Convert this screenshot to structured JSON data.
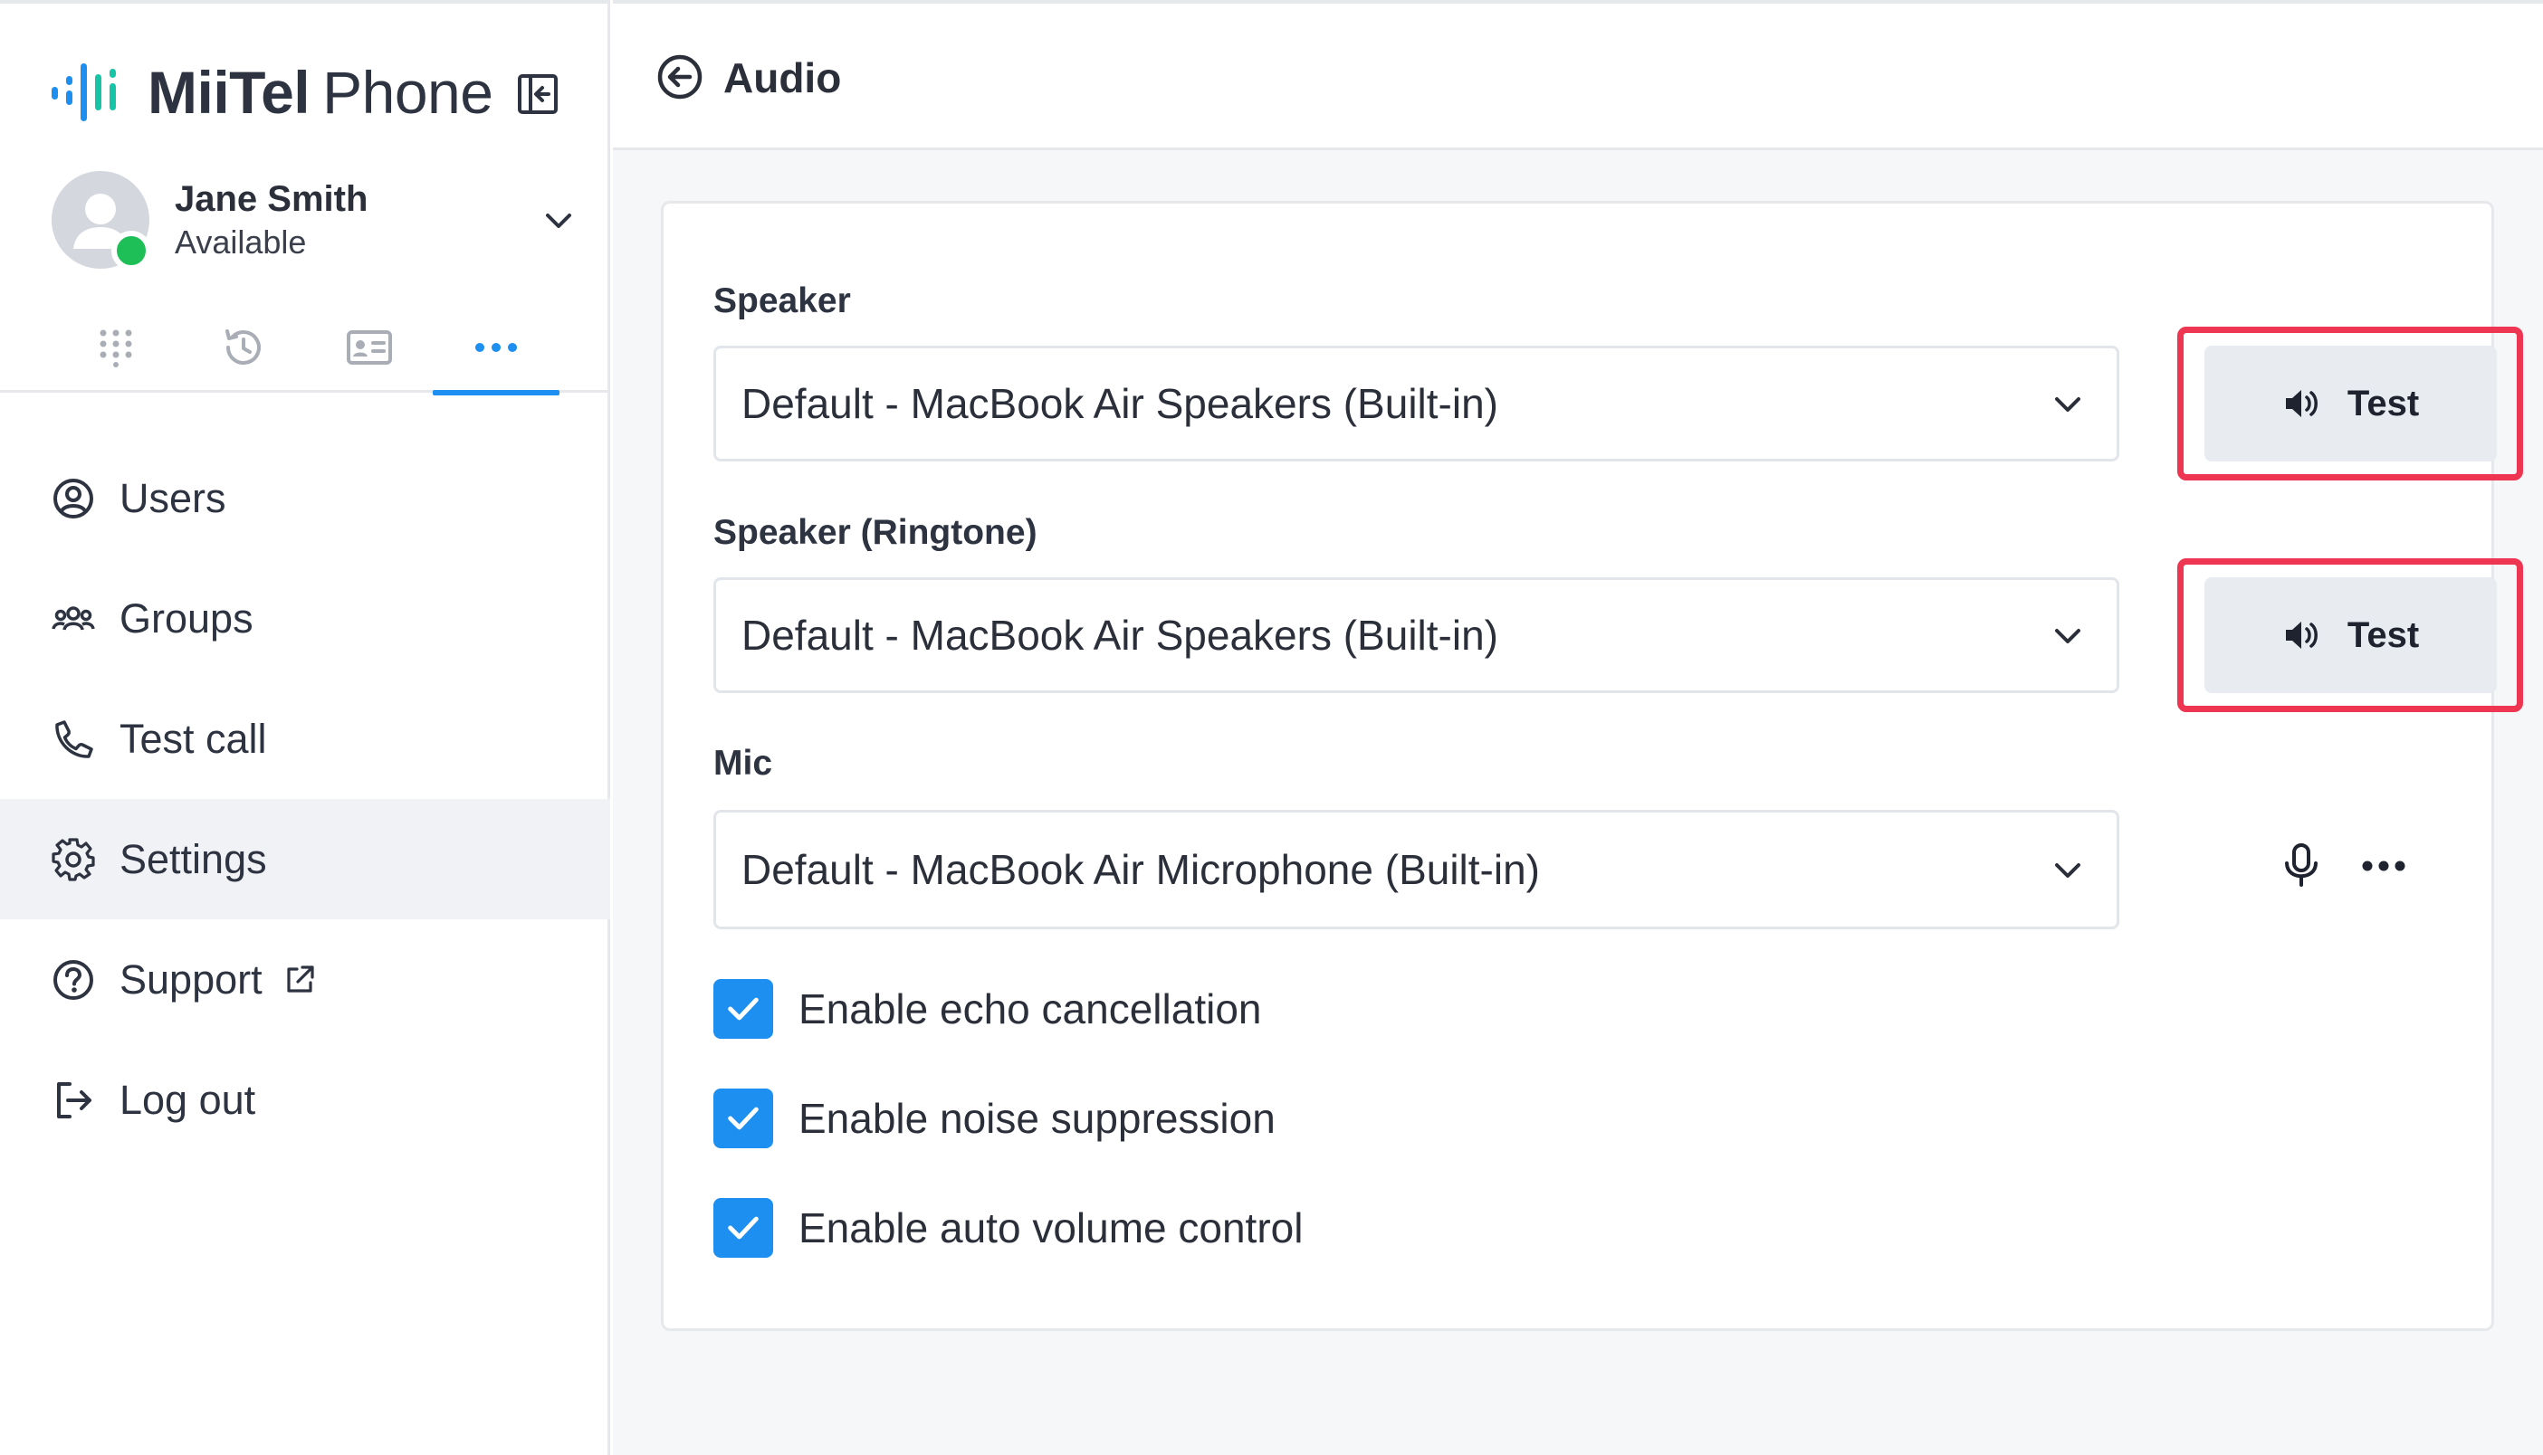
{
  "brand": {
    "name_part1": "MiiTel",
    "name_part2": "Phone"
  },
  "user": {
    "name": "Jane Smith",
    "status": "Available"
  },
  "menu": [
    {
      "label": "Users"
    },
    {
      "label": "Groups"
    },
    {
      "label": "Test call"
    },
    {
      "label": "Settings"
    },
    {
      "label": "Support"
    },
    {
      "label": "Log out"
    }
  ],
  "page": {
    "title": "Audio"
  },
  "speaker": {
    "label": "Speaker",
    "value": "Default - MacBook Air Speakers (Built-in)",
    "test_label": "Test"
  },
  "ringtone": {
    "label": "Speaker (Ringtone)",
    "value": "Default - MacBook Air Speakers (Built-in)",
    "test_label": "Test"
  },
  "mic": {
    "label": "Mic",
    "value": "Default - MacBook Air Microphone (Built-in)"
  },
  "options": [
    {
      "label": "Enable echo cancellation",
      "checked": true
    },
    {
      "label": "Enable noise suppression",
      "checked": true
    },
    {
      "label": "Enable auto volume control",
      "checked": true
    }
  ],
  "colors": {
    "accent": "#1c8ff0",
    "presence": "#1fbf58",
    "highlight": "#ee3652",
    "active_menu_bg": "#f1f2f5"
  },
  "icons": {
    "logo": "audio-wave-logo-icon",
    "collapse": "sidebar-collapse-icon",
    "tabs": [
      "dialpad-icon",
      "history-icon",
      "contact-card-icon",
      "more-dots-icon"
    ],
    "menu": [
      "user-circle-icon",
      "groups-icon",
      "phone-icon",
      "gear-icon",
      "help-circle-icon",
      "logout-icon"
    ]
  }
}
